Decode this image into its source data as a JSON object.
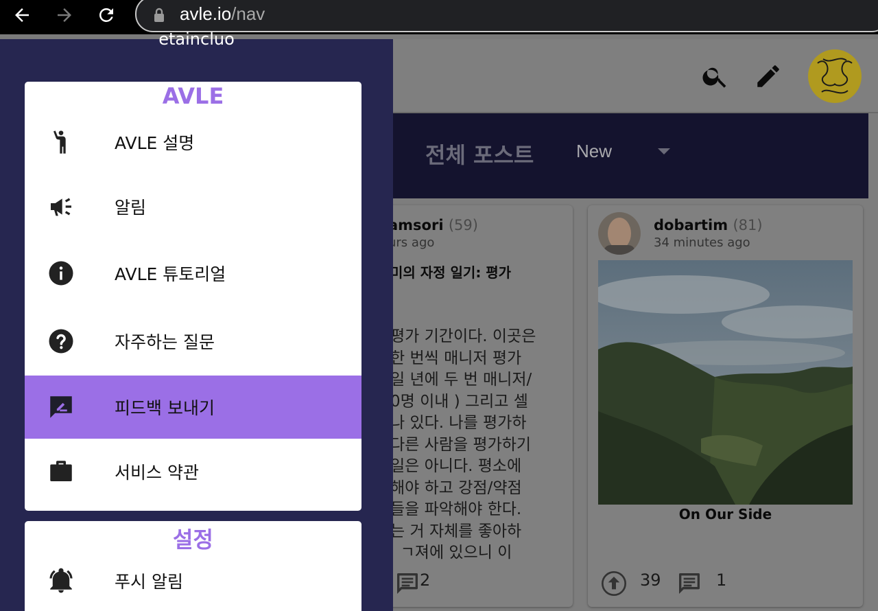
{
  "browser": {
    "url_host": "avle.io",
    "url_path": "/nav"
  },
  "drawer": {
    "username": "etaincluo",
    "sections": [
      {
        "title": "AVLE",
        "items": [
          {
            "label": "AVLE 설명",
            "icon": "person-waving-icon"
          },
          {
            "label": "알림",
            "icon": "megaphone-icon"
          },
          {
            "label": "AVLE 튜토리얼",
            "icon": "info-icon"
          },
          {
            "label": "자주하는 질문",
            "icon": "help-icon"
          },
          {
            "label": "피드백 보내기",
            "icon": "feedback-icon",
            "active": true
          },
          {
            "label": "서비스 약관",
            "icon": "briefcase-icon"
          }
        ]
      },
      {
        "title": "설정",
        "items": [
          {
            "label": "푸시 알림",
            "icon": "bell-icon"
          }
        ]
      }
    ]
  },
  "app": {
    "tabs": {
      "all_posts": "전체 포스트",
      "sort": "New"
    },
    "cards": [
      {
        "author": "amsori",
        "score": "(59)",
        "time": "urs ago",
        "title": "미의 자정 일기: 평가",
        "body": "평가 기간이다. 이곳은\n한 번씩 매니저 평가\n일 년에 두 번 매니저/\n0명 이내 ) 그리고 셀\n나 있다. 나를 평가하\n다른 사람을 평가하기\n일은 아니다. 평소에\n해야 하고 강점/약점\n들을 파악해야 한다.\n는 거 자체를 좋아하\n  ㄱ져에 있으니 이",
        "comments": "2"
      },
      {
        "author": "dobartim",
        "score": "(81)",
        "time": "34 minutes ago",
        "title": "On Our Side",
        "upvotes": "39",
        "comments": "1"
      }
    ]
  },
  "colors": {
    "accent": "#9b6fe6",
    "drawer_bg": "#262650",
    "tabbar_bg": "#14132e"
  }
}
